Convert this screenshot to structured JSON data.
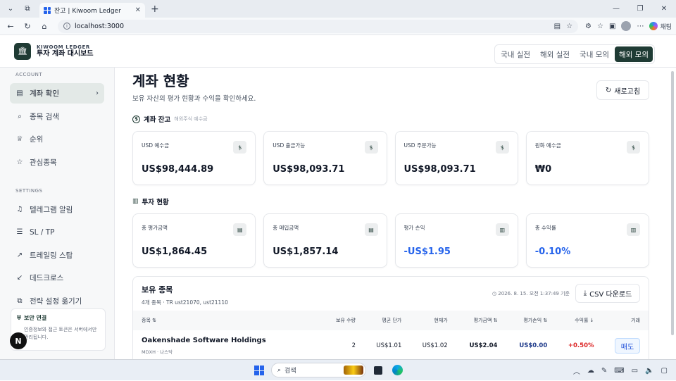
{
  "browser": {
    "tab_title": "잔고 | Kiwoom Ledger",
    "url": "localhost:3000",
    "profile_label": "채팅"
  },
  "header": {
    "brand_top": "KIWOOM LEDGER",
    "brand_bottom": "투자 계좌 대시보드",
    "modes": [
      "국내 실전",
      "해외 실전",
      "국내 모의",
      "해외 모의"
    ],
    "active_mode": "해외 모의"
  },
  "sidebar": {
    "account_heading": "ACCOUNT",
    "account_items": [
      {
        "label": "계좌 확인",
        "icon": "wallet-icon"
      },
      {
        "label": "종목 검색",
        "icon": "search-icon"
      },
      {
        "label": "순위",
        "icon": "trophy-icon"
      },
      {
        "label": "관심종목",
        "icon": "star-icon"
      }
    ],
    "settings_heading": "SETTINGS",
    "settings_items": [
      {
        "label": "텔레그램 알림",
        "icon": "bell-icon"
      },
      {
        "label": "SL / TP",
        "icon": "sliders-icon"
      },
      {
        "label": "트레일링 스탑",
        "icon": "trending-up-icon"
      },
      {
        "label": "데드크로스",
        "icon": "trending-down-icon"
      },
      {
        "label": "전략 설정 옮기기",
        "icon": "copy-icon"
      }
    ],
    "security": {
      "title": "보안 연결",
      "desc_1": "인증정보와 접근 토큰은 서버에서만",
      "desc_2": "관리됩니다."
    },
    "badge": "N"
  },
  "main": {
    "title": "계좌 현황",
    "subtitle": "보유 자산의 평가 현황과 수익을 확인하세요.",
    "refresh_label": "새로고침",
    "balance": {
      "heading": "계좌 잔고",
      "note": "해외주식 예수금",
      "cards": [
        {
          "label": "USD 예수금",
          "value": "US$98,444.89"
        },
        {
          "label": "USD 출금가능",
          "value": "US$98,093.71"
        },
        {
          "label": "USD 주문가능",
          "value": "US$98,093.71"
        },
        {
          "label": "원화 예수금",
          "value": "₩0"
        }
      ]
    },
    "investment": {
      "heading": "투자 현황",
      "cards": [
        {
          "label": "총 평가금액",
          "value": "US$1,864.45"
        },
        {
          "label": "총 매입금액",
          "value": "US$1,857.14"
        },
        {
          "label": "평가 손익",
          "value": "-US$1.95"
        },
        {
          "label": "총 수익률",
          "value": "-0.10%"
        }
      ]
    },
    "holdings": {
      "title": "보유 종목",
      "sub": "4개 종목 · TR ust21070, ust21110",
      "timestamp": "2026. 8. 15. 오전 1:37:49 기준",
      "csv_label": "CSV 다운로드",
      "columns": [
        "종목 ⇅",
        "보유 수량",
        "평균 단가",
        "현재가",
        "평가금액 ⇅",
        "평가손익 ⇅",
        "수익률 ↓",
        "거래"
      ],
      "rows": [
        {
          "name": "Oakenshade Software Holdings",
          "ticker": "MDXH · 나스닥",
          "qty": "2",
          "avg": "US$1.01",
          "price": "US$1.02",
          "eval": "US$2.04",
          "pnl": "US$0.00",
          "rate": "+0.50%",
          "action": "매도"
        }
      ]
    }
  },
  "taskbar": {
    "search_placeholder": "검색"
  }
}
